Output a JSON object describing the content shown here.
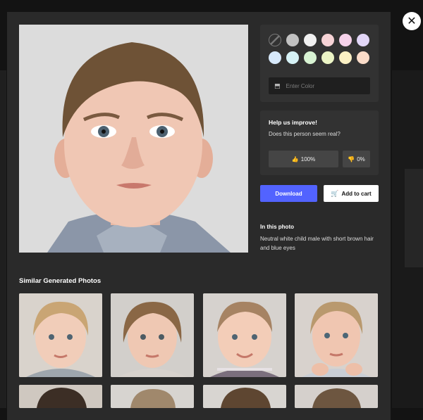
{
  "color_picker": {
    "swatches": [
      "none",
      "#c2c2c2",
      "#f1f1f1",
      "#f6d3d6",
      "#f5d1e9",
      "#e2d6f7",
      "#d7e9fb",
      "#d6f2f6",
      "#d8f3d3",
      "#ecf5c6",
      "#fbf0c4",
      "#fbdcc9"
    ],
    "placeholder": "Enter Color"
  },
  "feedback": {
    "title": "Help us improve!",
    "question": "Does this person seem real?",
    "yes_value": "100%",
    "no_value": "0%"
  },
  "actions": {
    "download_label": "Download",
    "cart_label": "Add to cart"
  },
  "info": {
    "heading": "In this photo",
    "description": "Neutral white child male with short brown hair and blue eyes"
  },
  "similar": {
    "heading": "Similar Generated Photos"
  },
  "colors": {
    "accent": "#5263ff",
    "modal_bg": "#2a2a2a",
    "panel_bg": "#323232"
  }
}
